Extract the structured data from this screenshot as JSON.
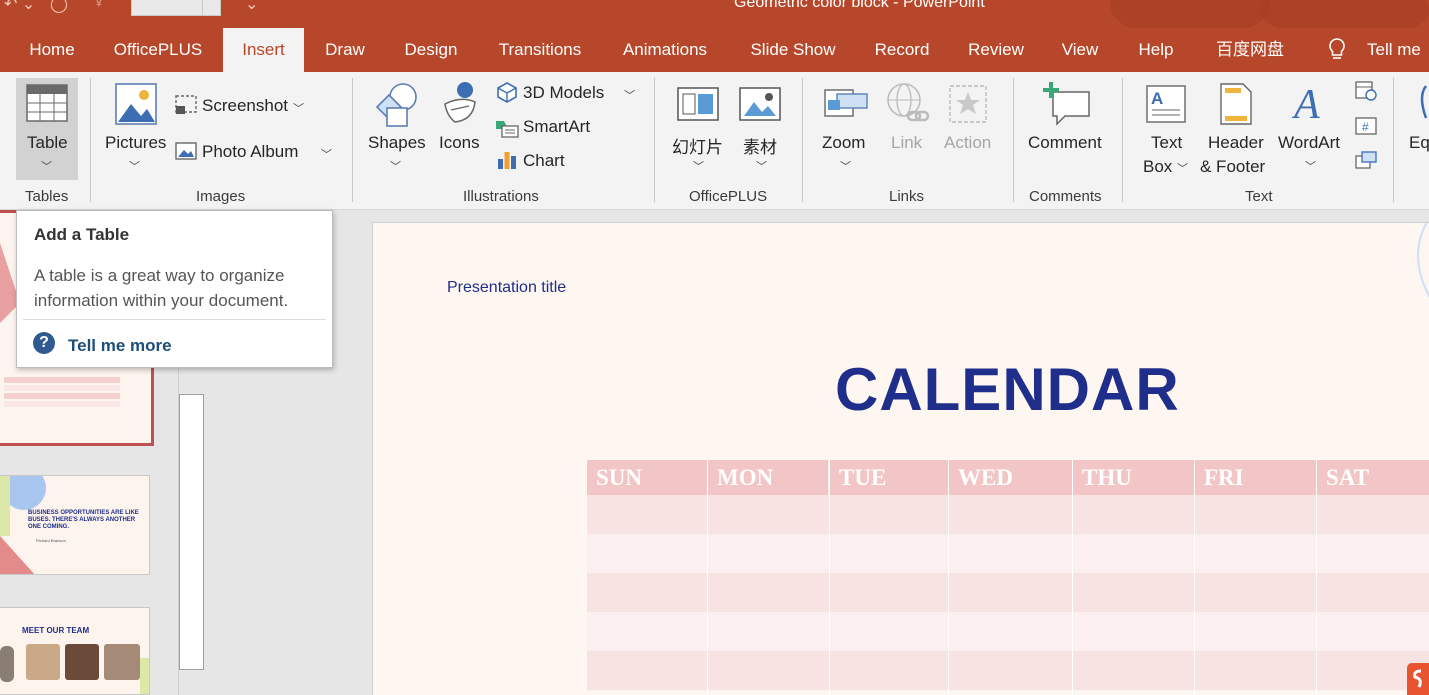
{
  "window": {
    "title": "Geometric color block  -  PowerPoint"
  },
  "tabs": [
    "Home",
    "OfficePLUS",
    "Insert",
    "Draw",
    "Design",
    "Transitions",
    "Animations",
    "Slide Show",
    "Record",
    "Review",
    "View",
    "Help",
    "百度网盘",
    "Tell me"
  ],
  "active_tab": "Insert",
  "ribbon": {
    "tables": {
      "table_label": "Table",
      "group": "Tables"
    },
    "images": {
      "pictures": "Pictures",
      "screenshot": "Screenshot",
      "photo_album": "Photo Album",
      "group": "Images"
    },
    "illustrations": {
      "shapes": "Shapes",
      "icons": "Icons",
      "models_3d": "3D Models",
      "smartart": "SmartArt",
      "chart": "Chart",
      "group": "Illustrations"
    },
    "officeplus": {
      "slides": "幻灯片",
      "material": "素材",
      "group": "OfficePLUS"
    },
    "links": {
      "zoom": "Zoom",
      "link": "Link",
      "action": "Action",
      "group": "Links"
    },
    "comments": {
      "comment": "Comment",
      "group": "Comments"
    },
    "text": {
      "textbox_1": "Text",
      "textbox_2": "Box",
      "header_1": "Header",
      "header_2": "& Footer",
      "wordart": "WordArt",
      "group": "Text",
      "equation_partial": "Eq"
    }
  },
  "tooltip": {
    "title": "Add a Table",
    "body": "A table is a great way to organize information within your document.",
    "link": "Tell me more",
    "help_glyph": "?"
  },
  "slide": {
    "presentation_title": "Presentation title",
    "heading": "CALENDAR",
    "days": [
      "SUN",
      "MON",
      "TUE",
      "WED",
      "THU",
      "FRI",
      "SAT"
    ]
  },
  "thumbnails": {
    "quote": "BUSINESS OPPORTUNITIES ARE LIKE BUSES. THERE'S ALWAYS ANOTHER ONE COMING.",
    "quote_author": "Richard Branson",
    "team_heading": "MEET OUR TEAM"
  },
  "colors": {
    "accent": "#b7472a",
    "navy": "#1f2e8a",
    "pink": "#f2c6c6"
  }
}
